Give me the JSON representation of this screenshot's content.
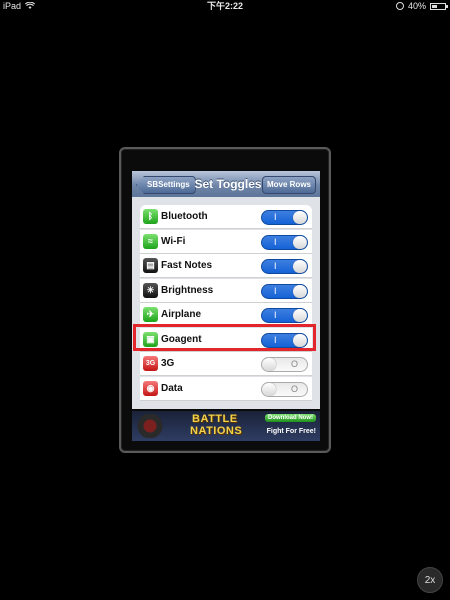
{
  "statusbar": {
    "device": "iPad",
    "time": "下午2:22",
    "battery": "40%",
    "battery_level": 0.4,
    "icons": [
      "wifi-icon",
      "rotation-lock-icon",
      "battery-icon"
    ]
  },
  "navbar": {
    "back_label": "SBSettings",
    "title": "Set Toggles",
    "right_label": "Move Rows"
  },
  "toggles": [
    {
      "label": "Bluetooth",
      "on": true,
      "icon": "bluetooth-icon",
      "color": "green"
    },
    {
      "label": "Wi-Fi",
      "on": true,
      "icon": "wifi-icon",
      "color": "green"
    },
    {
      "label": "Fast Notes",
      "on": true,
      "icon": "notes-icon",
      "color": "black"
    },
    {
      "label": "Brightness",
      "on": true,
      "icon": "brightness-icon",
      "color": "black"
    },
    {
      "label": "Airplane",
      "on": true,
      "icon": "airplane-icon",
      "color": "green"
    },
    {
      "label": "Goagent",
      "on": true,
      "icon": "goagent-icon",
      "color": "green"
    },
    {
      "label": "3G",
      "on": false,
      "icon": "3g-icon",
      "color": "red"
    },
    {
      "label": "Data",
      "on": false,
      "icon": "data-icon",
      "color": "red"
    }
  ],
  "switch_on_mark": "I",
  "switch_off_mark": "O",
  "ad": {
    "title_line1": "BATTLE",
    "title_line2": "NATIONS",
    "button": "Download Now!",
    "subtitle": "Fight For Free!"
  },
  "zoom_label": "2x"
}
